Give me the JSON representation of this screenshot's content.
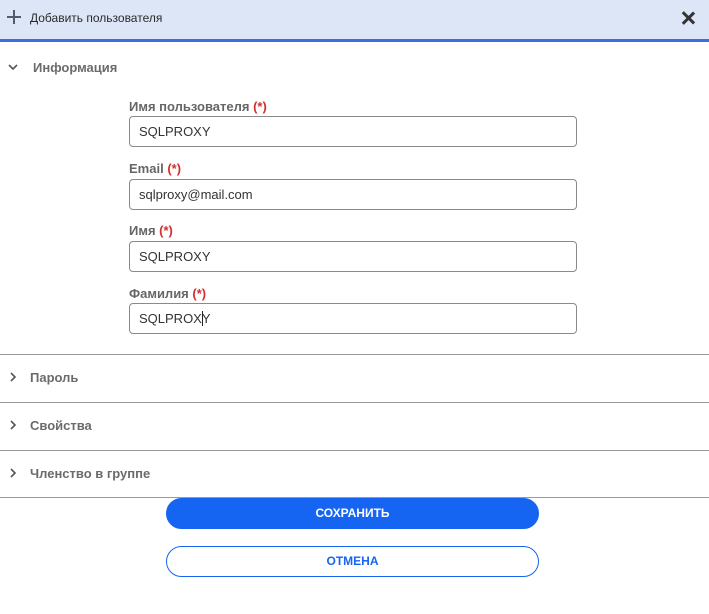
{
  "dialog": {
    "title": "Добавить пользователя"
  },
  "sections": [
    {
      "label": "Информация",
      "expanded": true
    },
    {
      "label": "Пароль",
      "expanded": false
    },
    {
      "label": "Свойства",
      "expanded": false
    },
    {
      "label": "Членство в группе",
      "expanded": false
    }
  ],
  "form": {
    "required_marker": "(*)",
    "username": {
      "label": "Имя пользователя",
      "value": "SQLPROXY"
    },
    "email": {
      "label": "Email",
      "value": "sqlproxy@mail.com"
    },
    "first_name": {
      "label": "Имя",
      "value": "SQLPROXY"
    },
    "last_name": {
      "label": "Фамилия",
      "value": "SQLPROXY"
    }
  },
  "buttons": {
    "save": "СОХРАНИТЬ",
    "cancel": "ОТМЕНА"
  },
  "colors": {
    "accent": "#1565f2",
    "header_bg": "#dde6f6",
    "required": "#d32f2f"
  },
  "icons": {
    "add": "plus-icon",
    "close": "close-icon",
    "expanded": "chevron-down-icon",
    "collapsed": "chevron-right-icon"
  }
}
